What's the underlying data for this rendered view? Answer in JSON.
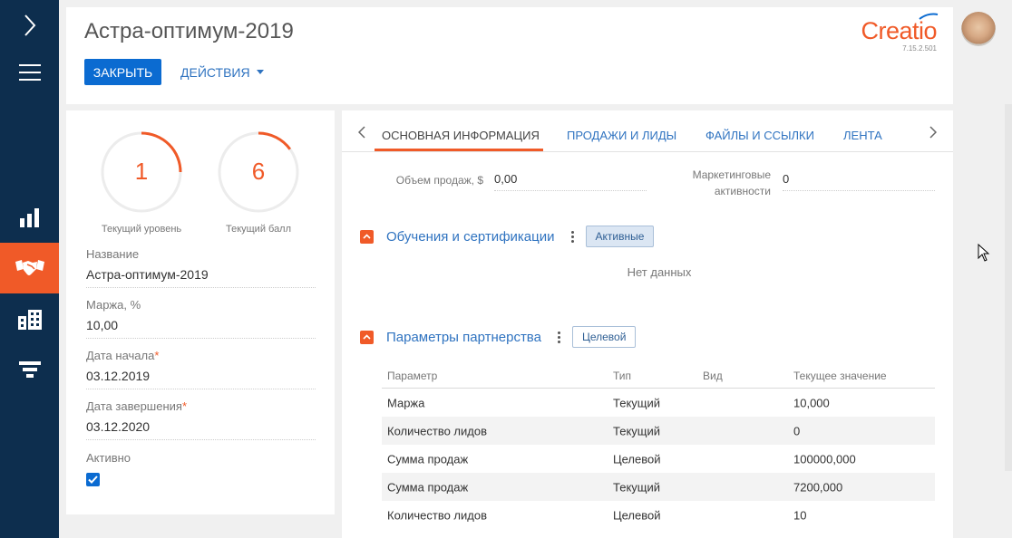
{
  "nav": {
    "items": [
      {
        "name": "expand-icon"
      },
      {
        "name": "menu-icon"
      },
      {
        "name": "dashboards-icon"
      },
      {
        "name": "partnerships-icon",
        "active": true
      },
      {
        "name": "accounts-icon"
      },
      {
        "name": "funnel-icon"
      }
    ]
  },
  "header": {
    "title": "Астра-оптимум-2019",
    "close_label": "ЗАКРЫТЬ",
    "actions_label": "ДЕЙСТВИЯ",
    "logo_text": "Creatio",
    "version": "7.15.2.501"
  },
  "profile": {
    "gauges": [
      {
        "value": "1",
        "label": "Текущий уровень",
        "fill": 0.25
      },
      {
        "value": "6",
        "label": "Текущий балл",
        "fill": 0.15
      }
    ],
    "fields": [
      {
        "label": "Название",
        "value": "Астра-оптимум-2019",
        "required": false
      },
      {
        "label": "Маржа, %",
        "value": "10,00",
        "required": false
      },
      {
        "label": "Дата начала",
        "value": "03.12.2019",
        "required": true
      },
      {
        "label": "Дата завершения",
        "value": "03.12.2020",
        "required": true
      }
    ],
    "active_label": "Активно",
    "active_checked": true
  },
  "tabs": [
    {
      "label": "ОСНОВНАЯ ИНФОРМАЦИЯ",
      "active": true
    },
    {
      "label": "ПРОДАЖИ И ЛИДЫ"
    },
    {
      "label": "ФАЙЛЫ И ССЫЛКИ"
    },
    {
      "label": "ЛЕНТА"
    }
  ],
  "summary": {
    "sales_label": "Объем продаж, $",
    "sales_value": "0,00",
    "marketing_label_1": "Маркетинговые",
    "marketing_label_2": "активности",
    "marketing_value": "0"
  },
  "training": {
    "title": "Обучения и сертификации",
    "filter": "Активные",
    "empty": "Нет данных"
  },
  "partnership": {
    "title": "Параметры партнерства",
    "filter": "Целевой",
    "columns": [
      "Параметр",
      "Тип",
      "Вид",
      "Текущее значение"
    ],
    "rows": [
      [
        "Маржа",
        "Текущий",
        "",
        "10,000"
      ],
      [
        "Количество лидов",
        "Текущий",
        "",
        "0"
      ],
      [
        "Сумма продаж",
        "Целевой",
        "",
        "100000,000"
      ],
      [
        "Сумма продаж",
        "Текущий",
        "",
        "7200,000"
      ],
      [
        "Количество лидов",
        "Целевой",
        "",
        "10"
      ]
    ]
  },
  "colors": {
    "accent": "#f05a28",
    "primary": "#0b6bd1",
    "nav_bg": "#0d2e4e",
    "link": "#2f73c0"
  }
}
